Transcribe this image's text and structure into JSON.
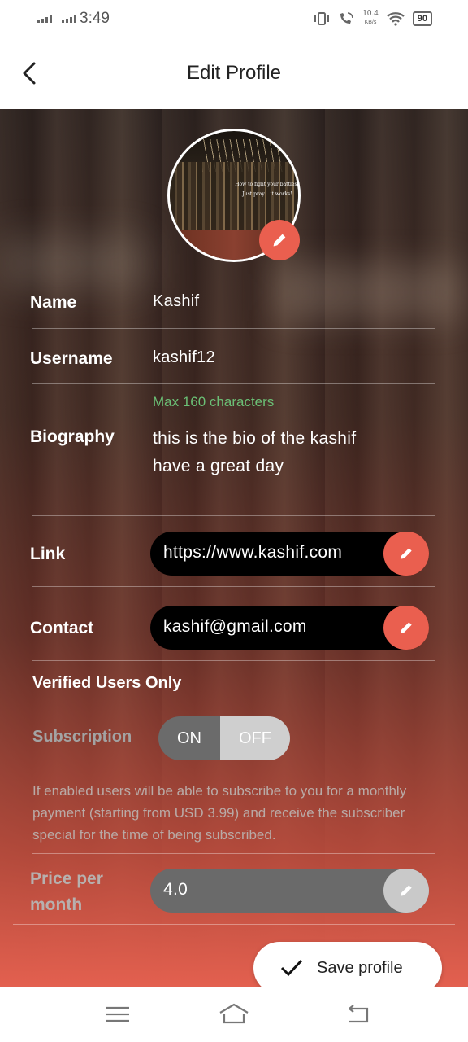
{
  "status_bar": {
    "time": "3:49",
    "speed_value": "10.4",
    "speed_unit": "KB/s",
    "battery": "90"
  },
  "header": {
    "title": "Edit Profile"
  },
  "avatar": {
    "quote_line1": "How to fight your battles?",
    "quote_line2": "Just pray... it works!"
  },
  "profile": {
    "name_label": "Name",
    "name_value": "Kashif",
    "username_label": "Username",
    "username_value": "kashif12",
    "bio_hint": "Max 160 characters",
    "bio_label": "Biography",
    "bio_line1": "this is the bio of the kashif",
    "bio_line2": "have a great day",
    "link_label": "Link",
    "link_value": "https://www.kashif.com",
    "contact_label": "Contact",
    "contact_value": "kashif@gmail.com"
  },
  "verified": {
    "title": "Verified Users Only",
    "subscription_label": "Subscription",
    "toggle_on": "ON",
    "toggle_off": "OFF",
    "description": "If enabled users will be able to subscribe to you for a monthly payment (starting from USD 3.99) and receive the subscriber special for the time of being subscribed.",
    "price_label_line1": "Price per",
    "price_label_line2": "month",
    "price_value": "4.0"
  },
  "actions": {
    "save_label": "Save profile"
  },
  "colors": {
    "accent": "#ea5f4f",
    "hint": "#6bbf75"
  },
  "icons": [
    "back-icon",
    "pencil-icon",
    "check-icon",
    "menu-icon",
    "home-icon",
    "return-icon"
  ]
}
